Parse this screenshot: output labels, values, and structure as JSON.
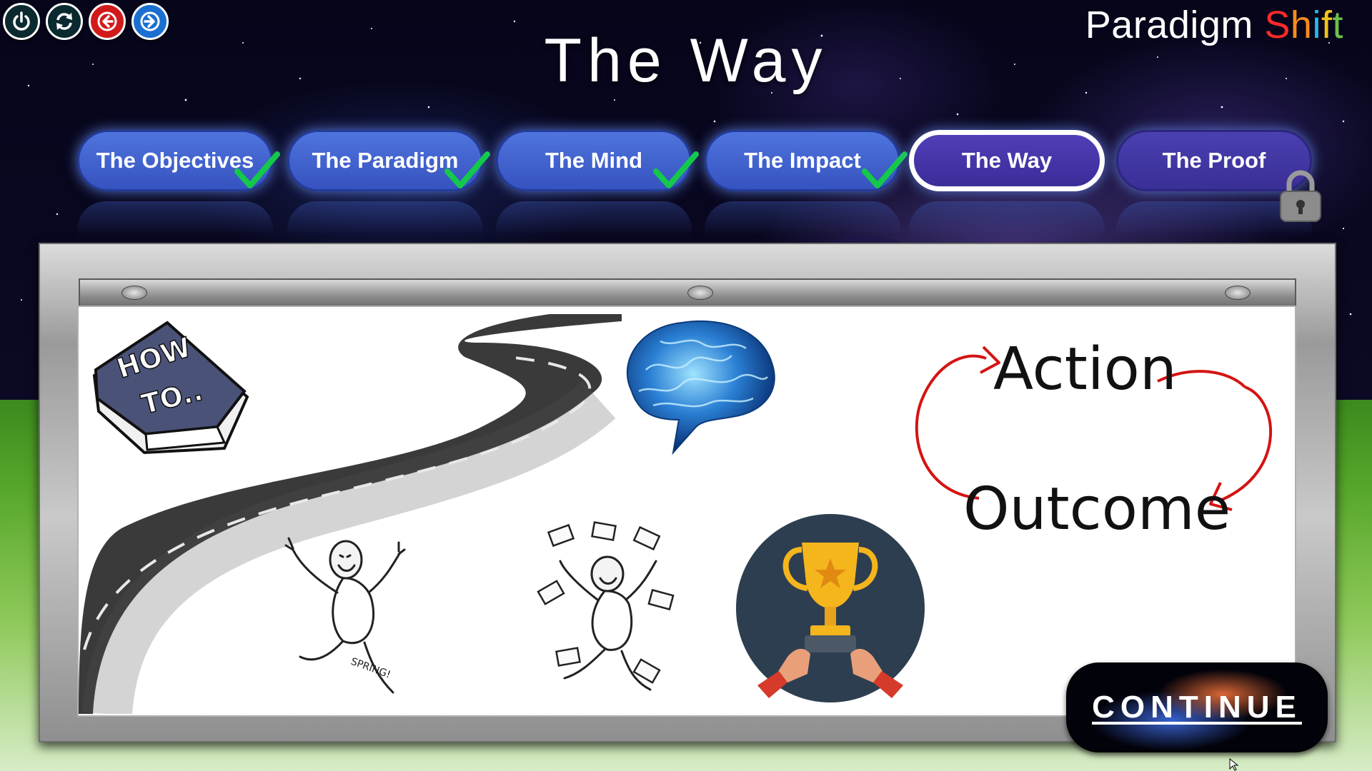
{
  "app": {
    "brand_prefix": "Paradigm ",
    "brand_suffix": [
      "S",
      "h",
      "i",
      "f",
      "t"
    ],
    "brand_suffix_colors": [
      "#ff2a2a",
      "#ff8c1a",
      "#2bb7e6",
      "#f0c419",
      "#6cc04a"
    ],
    "page_title": "The Way"
  },
  "controls": [
    {
      "name": "power-icon",
      "color": "#0b2a30"
    },
    {
      "name": "refresh-icon",
      "color": "#0b2a30"
    },
    {
      "name": "back-arrow-icon",
      "color": "#d11a1a"
    },
    {
      "name": "forward-arrow-icon",
      "color": "#1a6fd1"
    }
  ],
  "tabs": [
    {
      "label": "The Objectives",
      "completed": true,
      "active": false,
      "locked": false
    },
    {
      "label": "The Paradigm",
      "completed": true,
      "active": false,
      "locked": false
    },
    {
      "label": "The Mind",
      "completed": true,
      "active": false,
      "locked": false
    },
    {
      "label": "The Impact",
      "completed": true,
      "active": false,
      "locked": false
    },
    {
      "label": "The Way",
      "completed": false,
      "active": true,
      "locked": false
    },
    {
      "label": "The Proof",
      "completed": false,
      "active": false,
      "locked": true
    }
  ],
  "board": {
    "book_text_line1": "HOW",
    "book_text_line2": "TO..",
    "sketch_text": "SPRING!",
    "action_label": "Action",
    "outcome_label": "Outcome",
    "icons": [
      "road-illustration",
      "brain-illustration",
      "trophy-icon",
      "happy-man-illustration",
      "money-man-illustration",
      "how-to-book-icon"
    ]
  },
  "continue_button": {
    "label": "CONTINUE"
  },
  "colors": {
    "tab_blue": "#3f62d0",
    "tab_active": "#3f31a8",
    "check_green": "#14c94a",
    "cycle_arrow_red": "#d41313"
  }
}
